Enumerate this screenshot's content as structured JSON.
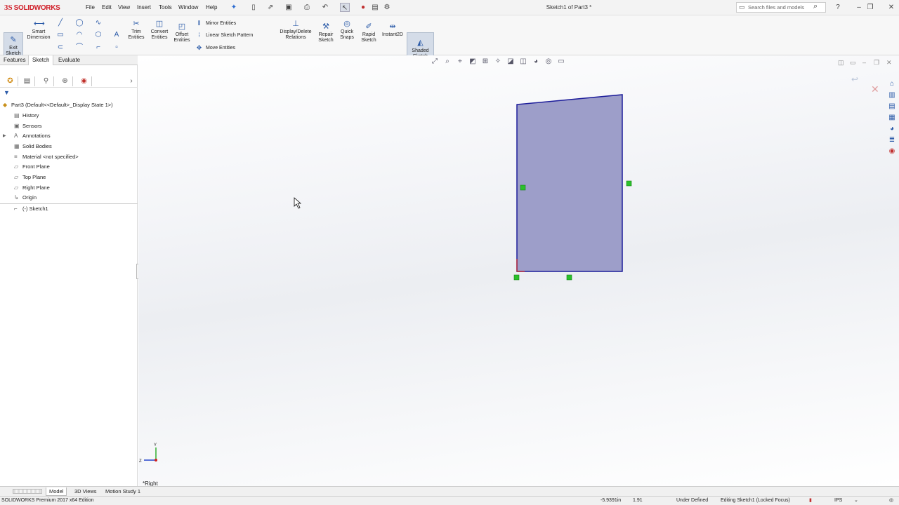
{
  "app": {
    "logo_prefix": "3S",
    "logo_text": "SOLIDWORKS",
    "doc_title": "Sketch1 of Part3 *"
  },
  "menu": [
    "File",
    "Edit",
    "View",
    "Insert",
    "Tools",
    "Window",
    "Help"
  ],
  "search": {
    "placeholder": "Search files and models"
  },
  "command_manager": {
    "exit_sketch": "Exit Sketch",
    "smart_dimension": "Smart Dimension",
    "trim_entities": "Trim Entities",
    "convert_entities": "Convert Entities",
    "offset_entities": "Offset Entities",
    "mirror_entities": "Mirror Entities",
    "linear_sketch_pattern": "Linear Sketch Pattern",
    "move_entities": "Move Entities",
    "display_delete_relations": "Display/Delete Relations",
    "repair_sketch": "Repair Sketch",
    "quick_snaps": "Quick Snaps",
    "rapid_sketch": "Rapid Sketch",
    "instant2d": "Instant2D",
    "shaded_sketch_contours": "Shaded Sketch Contours"
  },
  "tabs": [
    "Features",
    "Sketch",
    "Evaluate"
  ],
  "active_tab": "Sketch",
  "feature_tree": {
    "root": "Part3  (Default<<Default>_Display State 1>)",
    "items": [
      {
        "label": "History",
        "icon": "history-icon",
        "expandable": false
      },
      {
        "label": "Sensors",
        "icon": "sensors-icon",
        "expandable": false
      },
      {
        "label": "Annotations",
        "icon": "annotations-icon",
        "expandable": true
      },
      {
        "label": "Solid Bodies",
        "icon": "solid-bodies-icon",
        "expandable": false
      },
      {
        "label": "Material <not specified>",
        "icon": "material-icon",
        "expandable": false
      },
      {
        "label": "Front Plane",
        "icon": "plane-icon",
        "expandable": false
      },
      {
        "label": "Top Plane",
        "icon": "plane-icon",
        "expandable": false
      },
      {
        "label": "Right Plane",
        "icon": "plane-icon",
        "expandable": false
      },
      {
        "label": "Origin",
        "icon": "origin-icon",
        "expandable": false
      },
      {
        "label": "(-) Sketch1",
        "icon": "sketch-icon",
        "expandable": false
      }
    ]
  },
  "viewport": {
    "view_label": "*Right",
    "triad_y": "Y",
    "triad_z": "Z",
    "sketch_fill": "#9d9ec9",
    "sketch_edge": "#1d1d9a",
    "relation_color": "#2bc02b"
  },
  "bottom_tabs": [
    "Model",
    "3D Views",
    "Motion Study 1"
  ],
  "active_bottom_tab": "Model",
  "status": {
    "edition": "SOLIDWORKS Premium 2017 x64 Edition",
    "x_coord": "-5.9391in",
    "y_coord": "1.91",
    "definition": "Under Defined",
    "editing": "Editing Sketch1 (Locked Focus)",
    "units": "IPS"
  }
}
